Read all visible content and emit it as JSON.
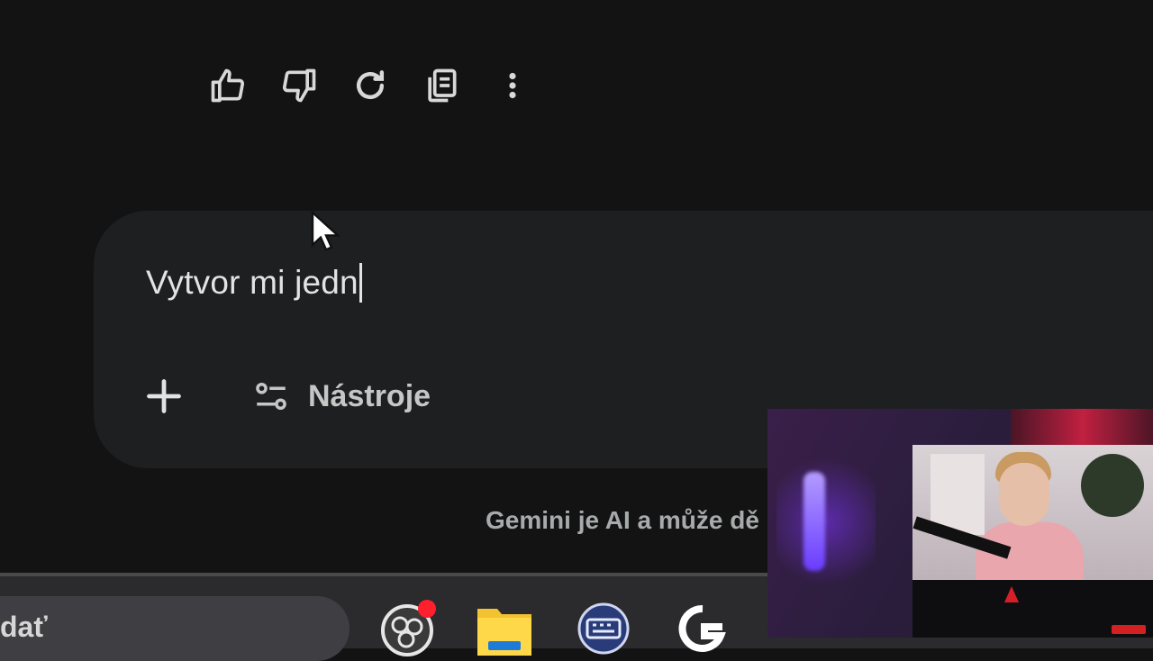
{
  "response_actions": {
    "like": "thumb-up-icon",
    "dislike": "thumb-down-icon",
    "regenerate": "refresh-icon",
    "copy": "copy-icon",
    "more": "more-vertical-icon"
  },
  "composer": {
    "input_value": "Vytvor mi jedn",
    "add_icon": "plus-icon",
    "tools_label": "Nástroje",
    "tools_icon": "tune-icon"
  },
  "footer": {
    "disclaimer": "Gemini je AI a může dě"
  },
  "taskbar": {
    "search_text": "dať",
    "icons": [
      "obs-icon",
      "file-explorer-icon",
      "keyboard-app-icon",
      "logitech-g-icon"
    ],
    "notification_color": "#ff1f2d"
  },
  "colors": {
    "background": "#131314",
    "composer": "#1e1f20",
    "text": "#e3e3e3",
    "muted": "#a8abab"
  }
}
